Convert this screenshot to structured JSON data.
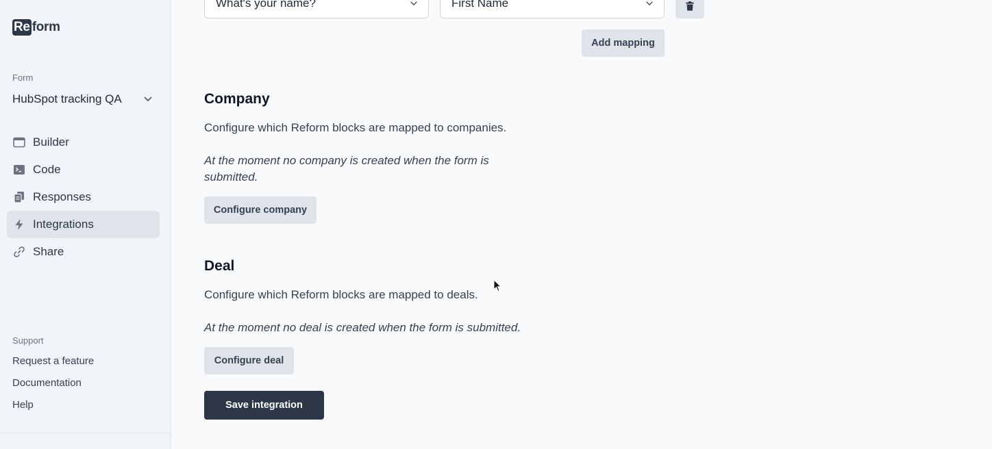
{
  "sidebar": {
    "logo": {
      "box": "Re",
      "rest": "form"
    },
    "form_label": "Form",
    "form_name": "HubSpot tracking QA",
    "nav": [
      {
        "label": "Builder",
        "icon": "browser-window-icon"
      },
      {
        "label": "Code",
        "icon": "terminal-icon"
      },
      {
        "label": "Responses",
        "icon": "documents-icon"
      },
      {
        "label": "Integrations",
        "icon": "lightning-icon",
        "active": true
      },
      {
        "label": "Share",
        "icon": "link-icon"
      }
    ],
    "support_label": "Support",
    "support_links": [
      "Request a feature",
      "Documentation",
      "Help"
    ]
  },
  "mapping": {
    "source_select": "What's your name?",
    "target_select": "First Name",
    "delete_icon": "trash-icon",
    "add_button": "Add mapping"
  },
  "company": {
    "heading": "Company",
    "description": "Configure which Reform blocks are mapped to companies.",
    "note": "At the moment no company is created when the form is submitted.",
    "button": "Configure company"
  },
  "deal": {
    "heading": "Deal",
    "description": "Configure which Reform blocks are mapped to deals.",
    "note": "At the moment no deal is created when the form is submitted.",
    "button": "Configure deal"
  },
  "save_button": "Save integration",
  "colors": {
    "sidebar_bg": "#f1f4f8",
    "main_bg": "#f9fafb",
    "primary_button": "#2d3748",
    "secondary_button": "#dfe3ea"
  }
}
